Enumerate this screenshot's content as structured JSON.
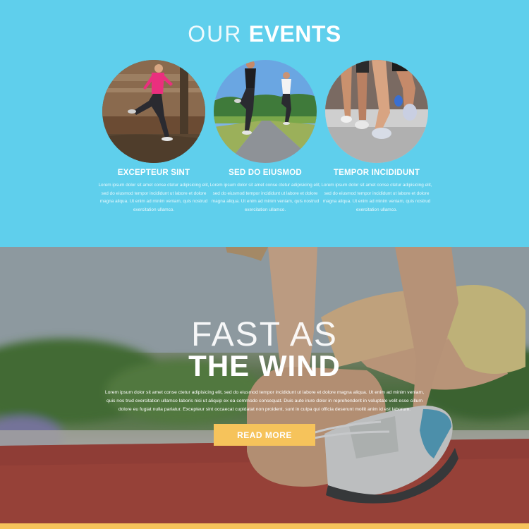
{
  "events": {
    "title_light": "OUR",
    "title_bold": "EVENTS",
    "items": [
      {
        "title": "EXCEPTEUR SINT",
        "text": "Lorem ipsum dolor sit amet conse ctetur adipisicing elit, sed do eiusmod tempor incididunt ut labore et dolore magna aliqua. Ut enim ad minim veniam, quis nostrud exercitation ullamco."
      },
      {
        "title": "SED DO EIUSMOD",
        "text": "Lorem ipsum dolor sit amet conse ctetur adipisicing elit, sed do eiusmod tempor incididunt ut labore et dolore magna aliqua. Ut enim ad minim veniam, quis nostrud exercitation ullamco."
      },
      {
        "title": "TEMPOR INCIDIDUNT",
        "text": "Lorem ipsum dolor sit amet conse ctetur adipisicing elit, sed do eiusmod tempor incididunt ut labore et dolore magna aliqua. Ut enim ad minim veniam, quis nostrud exercitation ullamco."
      }
    ]
  },
  "hero": {
    "title_light": "FAST AS",
    "title_bold": "THE WIND",
    "text": "Lorem ipsum dolor sit amet conse ctetur adipisicing elit, sed do eiusmod tempor incididunt ut labore et dolore magna aliqua. Ut enim ad minim veniam, quis nos trud exercitation ullamco laboris nisi ut aliquip ex ea commodo consequat. Duis aute irure dolor in reprehenderit in voluptate velit esse cillum dolore eu fugiat nulla pariatur. Excepteur sint occaecat cupidatat non proident, sunt in culpa qui officia deserunt mollit anim id est laborum.",
    "button_label": "READ MORE"
  },
  "colors": {
    "events_bg": "#5fcfec",
    "accent": "#f6c35b",
    "text": "#ffffff"
  }
}
